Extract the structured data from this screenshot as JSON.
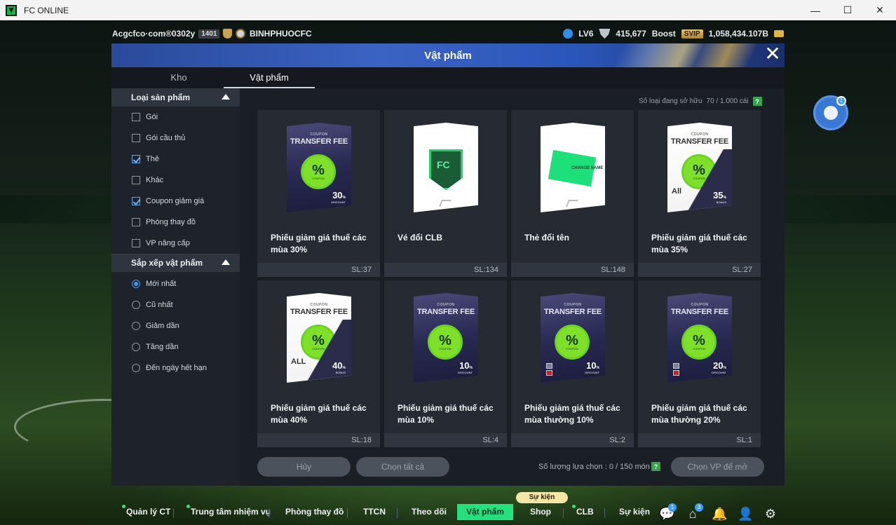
{
  "window": {
    "title": "FC ONLINE",
    "controls": [
      "—",
      "☐",
      "✕"
    ]
  },
  "topbar": {
    "account": "Acgcfco·com®0302y",
    "account_code": "1401",
    "club": "BINHPHUOCFC",
    "level": "LV6",
    "points": "415,677",
    "boost_label": "Boost",
    "svip_label": "SVIP",
    "bp": "1,058,434.107B"
  },
  "panel": {
    "title": "Vật phẩm",
    "tabs": [
      {
        "label": "Kho",
        "active": false
      },
      {
        "label": "Vật phẩm",
        "active": true
      }
    ]
  },
  "sidebar": {
    "product_type": {
      "title": "Loại sản phẩm",
      "items": [
        {
          "label": "Gói",
          "checked": false
        },
        {
          "label": "Gói cầu thủ",
          "checked": false
        },
        {
          "label": "Thẻ",
          "checked": true
        },
        {
          "label": "Khác",
          "checked": false
        },
        {
          "label": "Coupon giảm giá",
          "checked": true
        },
        {
          "label": "Phòng thay đồ",
          "checked": false
        },
        {
          "label": "VP nâng cấp",
          "checked": false
        }
      ]
    },
    "sort": {
      "title": "Sắp xếp vật phẩm",
      "items": [
        {
          "label": "Mới nhất",
          "selected": true
        },
        {
          "label": "Cũ nhất",
          "selected": false
        },
        {
          "label": "Giảm dần",
          "selected": false
        },
        {
          "label": "Tăng dần",
          "selected": false
        },
        {
          "label": "Đến ngày hết hạn",
          "selected": false
        }
      ]
    }
  },
  "owned": {
    "label": "Số loại đang sở hữu",
    "value": "70 / 1.000 cái",
    "help": "?"
  },
  "items": [
    {
      "name": "Phiếu giảm giá thuế các mùa 30%",
      "qty": "SL:37",
      "kind": "coupon-dark",
      "value": "30",
      "sub": "DISCOUNT"
    },
    {
      "name": "Vé đổi CLB",
      "qty": "SL:134",
      "kind": "club"
    },
    {
      "name": "Thẻ đổi tên",
      "qty": "SL:148",
      "kind": "rename",
      "card_text": "CHANGE NAME"
    },
    {
      "name": "Phiếu giảm giá thuế các mùa 35%",
      "qty": "SL:27",
      "kind": "coupon-light",
      "value": "35",
      "sub": "BONUS",
      "all": "All"
    },
    {
      "name": "Phiếu giảm giá thuế các mùa 40%",
      "qty": "SL:18",
      "kind": "coupon-light",
      "value": "40",
      "sub": "BONUS",
      "all": "ALL"
    },
    {
      "name": "Phiếu giảm giá thuế các mùa 10%",
      "qty": "SL:4",
      "kind": "coupon-dark",
      "value": "10",
      "sub": "DISCOUNT"
    },
    {
      "name": "Phiếu giảm giá thuế các mùa thường 10%",
      "qty": "SL:2",
      "kind": "coupon-dark-restricted",
      "value": "10",
      "sub": "DISCOUNT"
    },
    {
      "name": "Phiếu giảm giá thuế các mùa thường 20%",
      "qty": "SL:1",
      "kind": "coupon-dark-restricted",
      "value": "20",
      "sub": "DISCOUNT"
    }
  ],
  "coupon_text": {
    "coupon": "COUPON",
    "transfer_fee": "TRANSFER FEE",
    "badge_pct": "%",
    "badge_label": "COUPON"
  },
  "actions": {
    "cancel": "Hủy",
    "select_all": "Chọn tất cả",
    "selected_count": "Số lượng lựa chọn : 0 / 150 món",
    "help": "?",
    "open": "Chọn VP để mở"
  },
  "chat": {
    "badge": "1"
  },
  "bottom_nav": {
    "items": [
      "Quản lý CT",
      "Trung tâm nhiệm vụ",
      "Phòng thay đồ",
      "TTCN",
      "Theo dõi",
      "Vật phẩm",
      "Shop",
      "CLB",
      "Sự kiện"
    ],
    "event_tag": "Sự kiện",
    "icon_badges": {
      "chat": "1",
      "home": "3"
    }
  },
  "colors": {
    "accent": "#25e07e",
    "panel_header": "#3b63c4",
    "checkbox": "#68b3ff"
  }
}
